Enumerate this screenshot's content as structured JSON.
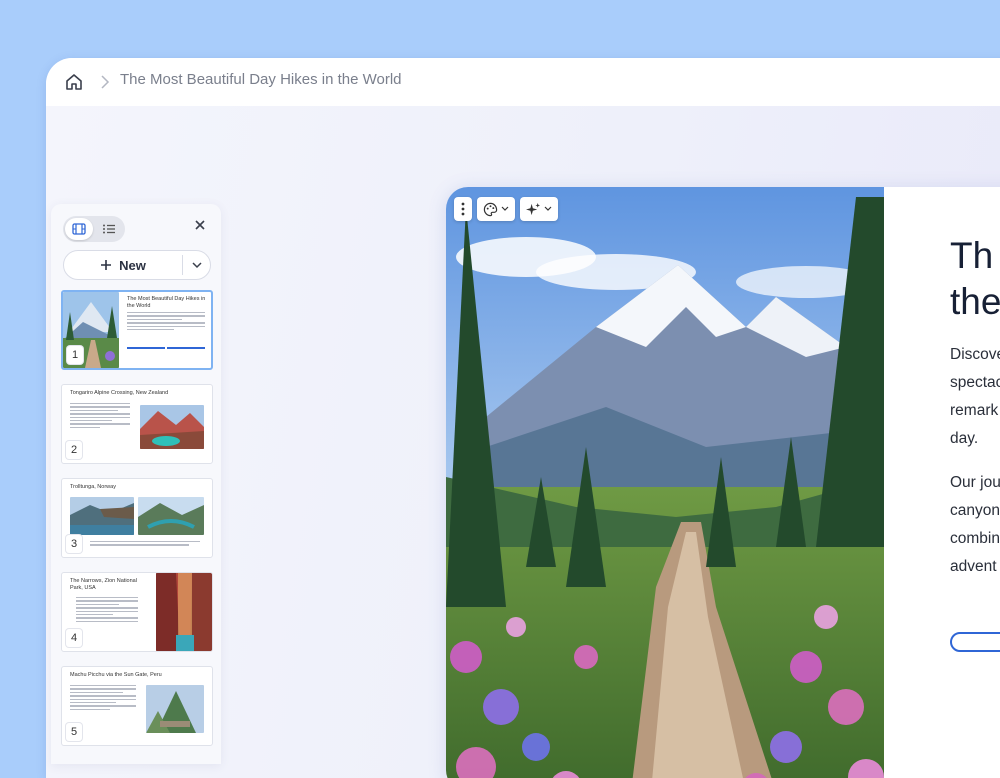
{
  "breadcrumb": {
    "home_icon": "home-icon",
    "title": "The Most Beautiful Day Hikes in the World"
  },
  "panel": {
    "new_label": "New",
    "slides": [
      {
        "number": "1",
        "title": "The Most Beautiful Day Hikes in the World"
      },
      {
        "number": "2",
        "title": "Tongariro Alpine Crossing, New Zealand"
      },
      {
        "number": "3",
        "title": "Trolltunga, Norway"
      },
      {
        "number": "4",
        "title": "The Narrows, Zion National Park, USA"
      },
      {
        "number": "5",
        "title": "Machu Picchu via the Sun Gate, Peru"
      }
    ]
  },
  "main_slide": {
    "title": "The Most Beautiful Day Hikes in the World",
    "title_visible": "Th\nthe",
    "para1_visible": "Discove\nspectac\nremark\nday.",
    "para2_visible": "Our jou\ncanyon\ncombin\nadvent"
  },
  "colors": {
    "accent": "#2f66d6",
    "selected_border": "#7fb3f2",
    "background": "#a9cdfb"
  }
}
